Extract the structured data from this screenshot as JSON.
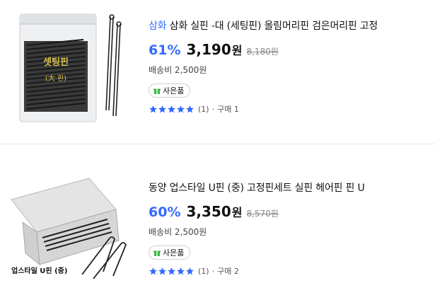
{
  "products": [
    {
      "brand": "삼화",
      "title": "삼화 실핀 -대 (세팅핀) 올림머리핀 검은머리핀 고정",
      "discount": "61%",
      "price": "3,190",
      "currency": "원",
      "original_price": "8,180원",
      "shipping": "배송비 2,500원",
      "gift_label": "사은품",
      "rating_stars": 5,
      "review_count": "(1)",
      "separator": "·",
      "purchase_count": "구매 1",
      "image_label": "셋팅핀",
      "image_sublabel": "(大 핀)"
    },
    {
      "brand": "",
      "title": "동양 업스타일 U핀 (중) 고정핀세트 실핀 헤어핀 핀 U",
      "discount": "60%",
      "price": "3,350",
      "currency": "원",
      "original_price": "8,570원",
      "shipping": "배송비 2,500원",
      "gift_label": "사은품",
      "rating_stars": 5,
      "review_count": "(1)",
      "separator": "·",
      "purchase_count": "구매 2",
      "image_label": "업스타일 U핀 (중)"
    }
  ],
  "colors": {
    "accent": "#346aff",
    "star": "#346aff",
    "gift_green": "#3db64a",
    "divider": "#e6e6e6"
  },
  "icons": {
    "star": "star-icon",
    "gift": "gift-icon"
  }
}
